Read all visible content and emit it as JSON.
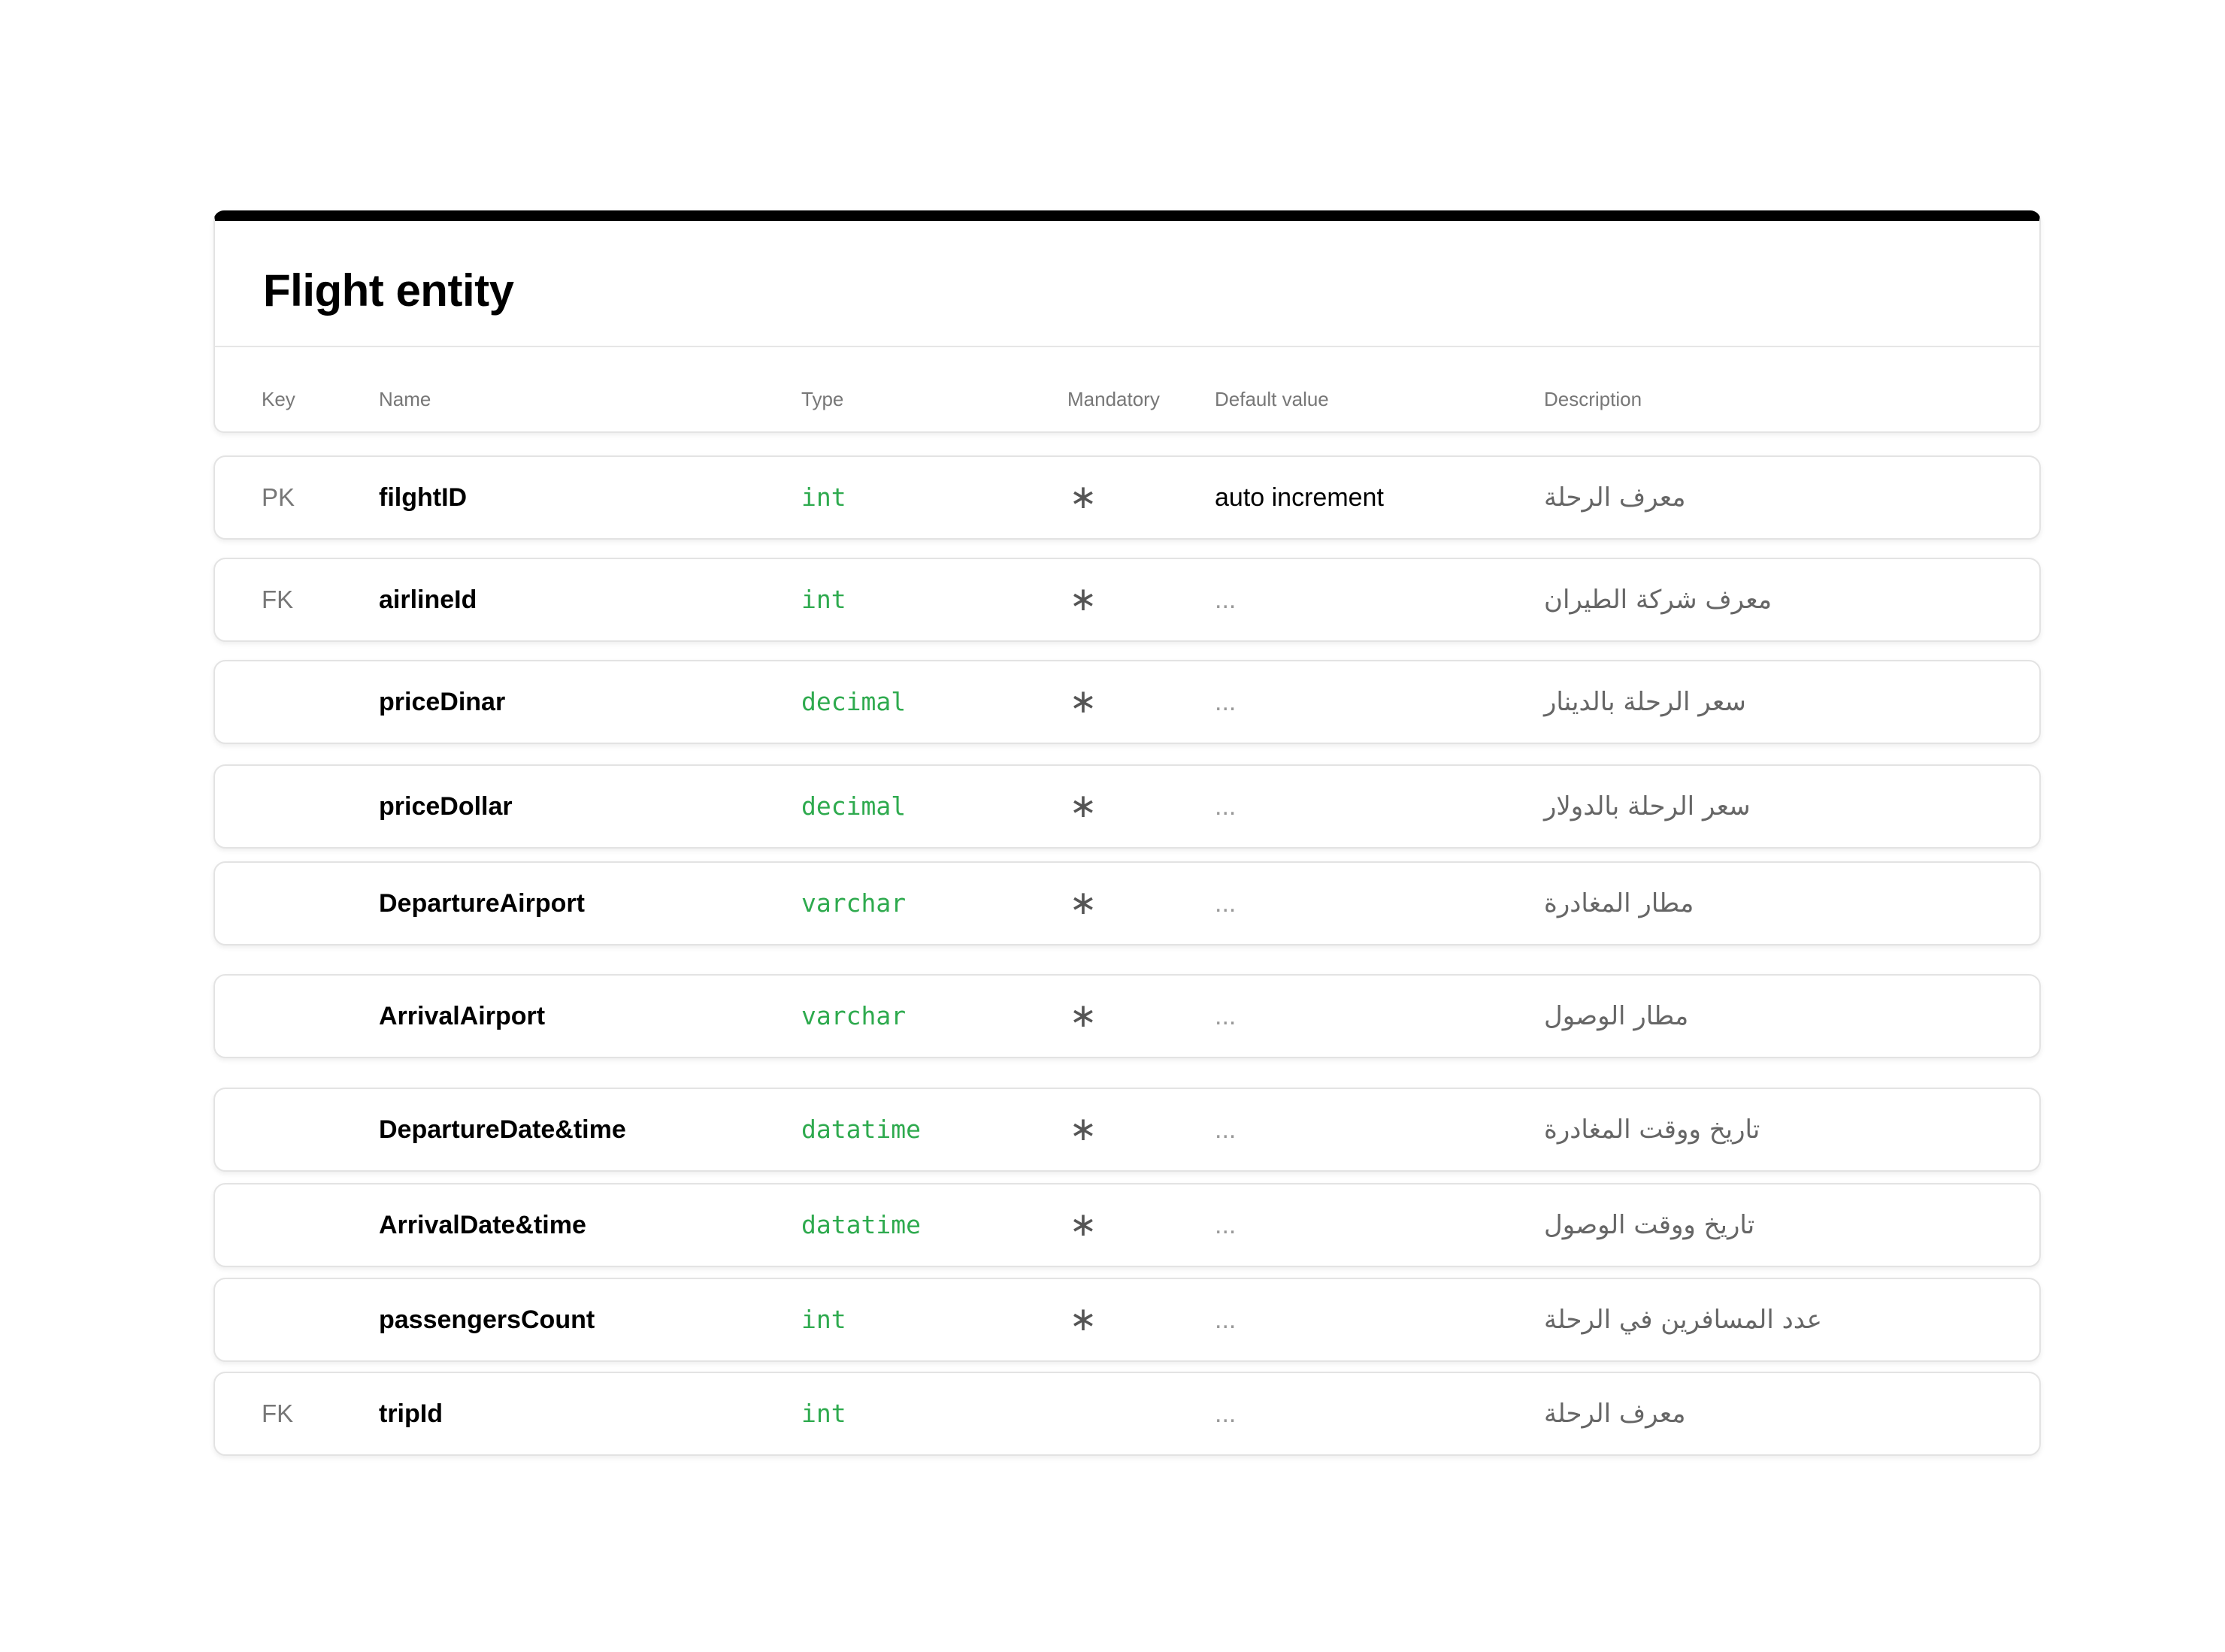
{
  "entity": {
    "title": "Flight entity"
  },
  "columns": {
    "key": "Key",
    "name": "Name",
    "type": "Type",
    "mandatory": "Mandatory",
    "default": "Default value",
    "description": "Description"
  },
  "colors": {
    "type_text": "#2eaa4e",
    "header_bar": "#000000",
    "muted_text": "#777777"
  },
  "rows": [
    {
      "key": "PK",
      "name": "filghtID",
      "type": "int",
      "mandatory": "∗",
      "default": "auto increment",
      "description": "معرف الرحلة"
    },
    {
      "key": "FK",
      "name": "airlineId",
      "type": "int",
      "mandatory": "∗",
      "default": "...",
      "description": "معرف شركة الطيران"
    },
    {
      "key": "",
      "name": "priceDinar",
      "type": "decimal",
      "mandatory": "∗",
      "default": "...",
      "description": "سعر الرحلة بالدينار"
    },
    {
      "key": "",
      "name": "priceDollar",
      "type": "decimal",
      "mandatory": "∗",
      "default": "...",
      "description": "سعر الرحلة بالدولار"
    },
    {
      "key": "",
      "name": "DepartureAirport",
      "type": "varchar",
      "mandatory": "∗",
      "default": "...",
      "description": "مطار المغادرة"
    },
    {
      "key": "",
      "name": "ArrivalAirport",
      "type": "varchar",
      "mandatory": "∗",
      "default": "...",
      "description": "مطار الوصول"
    },
    {
      "key": "",
      "name": "DepartureDate&time",
      "type": "datatime",
      "mandatory": "∗",
      "default": "...",
      "description": "تاريخ ووقت المغادرة"
    },
    {
      "key": "",
      "name": "ArrivalDate&time",
      "type": "datatime",
      "mandatory": "∗",
      "default": "...",
      "description": "تاريخ ووقت الوصول"
    },
    {
      "key": "",
      "name": "passengersCount",
      "type": "int",
      "mandatory": "∗",
      "default": "...",
      "description": "عدد المسافرين في الرحلة"
    },
    {
      "key": "FK",
      "name": "tripId",
      "type": "int",
      "mandatory": "",
      "default": "...",
      "description": "معرف الرحلة"
    }
  ]
}
